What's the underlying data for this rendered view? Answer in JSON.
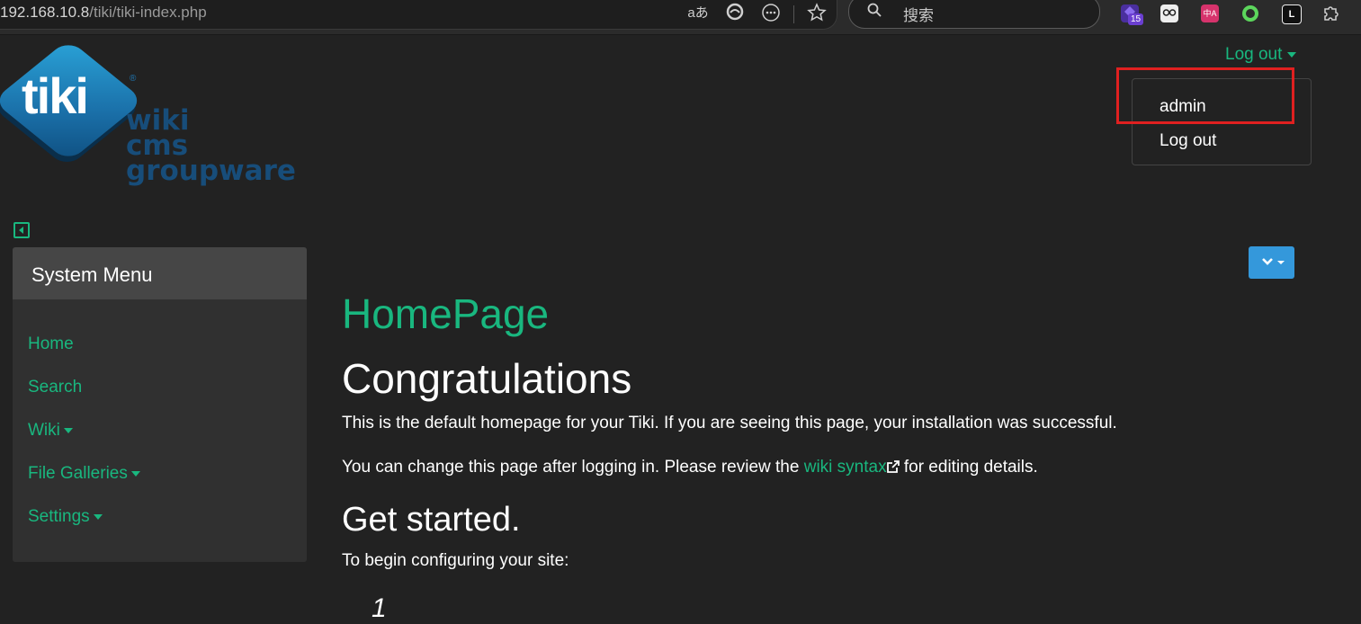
{
  "browser": {
    "url_host": "192.168.10.8",
    "url_path": "/tiki/tiki-index.php",
    "search_placeholder": "搜索",
    "ext_badge_count": "15",
    "translate_label": "aあ"
  },
  "logo": {
    "brand": "tiki",
    "registered": "®",
    "tagline_lines": [
      "wiki",
      "cms",
      "groupware"
    ]
  },
  "header": {
    "logout_toggle": "Log out",
    "dropdown": {
      "username": "admin",
      "logout": "Log out"
    }
  },
  "sidebar": {
    "title": "System Menu",
    "items": [
      {
        "label": "Home",
        "has_caret": false
      },
      {
        "label": "Search",
        "has_caret": false
      },
      {
        "label": "Wiki",
        "has_caret": true
      },
      {
        "label": "File Galleries",
        "has_caret": true
      },
      {
        "label": "Settings",
        "has_caret": true
      }
    ]
  },
  "main": {
    "page_title": "HomePage",
    "heading": "Congratulations",
    "para1": "This is the default homepage for your Tiki. If you are seeing this page, your installation was successful.",
    "para2_before": "You can change this page after logging in. Please review the ",
    "para2_link": "wiki syntax",
    "para2_after": " for editing details.",
    "subheading": "Get started.",
    "para3": "To begin configuring your site:",
    "list_first_number": "1"
  },
  "colors": {
    "accent": "#19b77f",
    "background": "#222222",
    "action_button": "#3498db",
    "highlight_box": "#e02020"
  }
}
